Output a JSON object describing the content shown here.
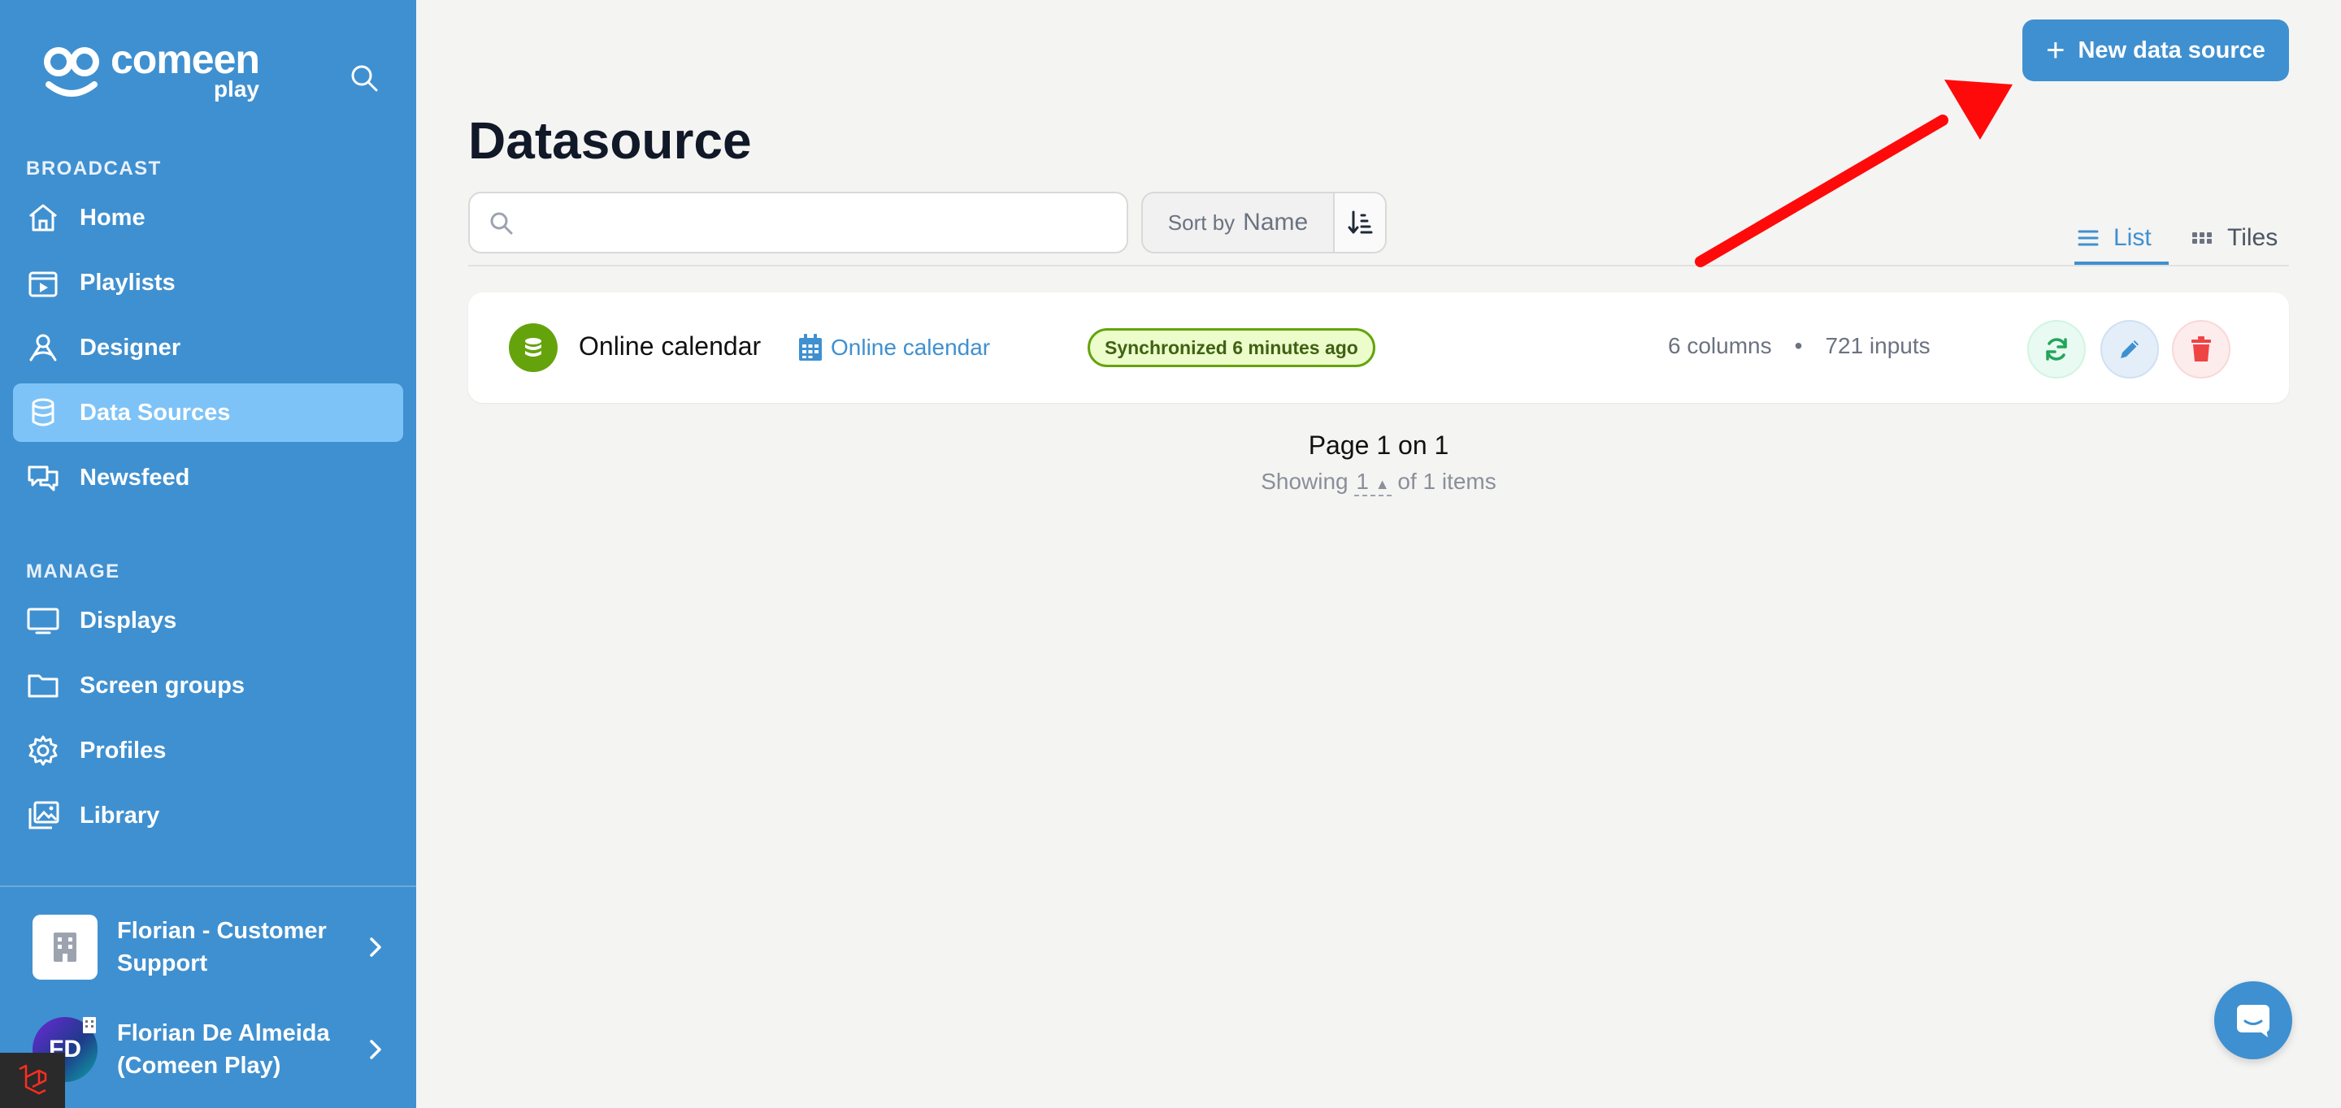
{
  "app": {
    "logo_text": "comeen",
    "logo_sub": "play"
  },
  "sidebar": {
    "sections": [
      {
        "label": "BROADCAST",
        "items": [
          {
            "label": "Home",
            "icon": "home-icon"
          },
          {
            "label": "Playlists",
            "icon": "playlist-icon"
          },
          {
            "label": "Designer",
            "icon": "designer-icon"
          },
          {
            "label": "Data Sources",
            "icon": "database-icon",
            "active": true
          },
          {
            "label": "Newsfeed",
            "icon": "newsfeed-icon"
          }
        ]
      },
      {
        "label": "MANAGE",
        "items": [
          {
            "label": "Displays",
            "icon": "display-icon"
          },
          {
            "label": "Screen groups",
            "icon": "folder-icon"
          },
          {
            "label": "Profiles",
            "icon": "gear-icon"
          },
          {
            "label": "Library",
            "icon": "library-icon"
          }
        ]
      }
    ],
    "org": {
      "name": "Florian - Customer Support"
    },
    "user": {
      "name": "Florian De Almeida (Comeen Play)",
      "initials": "FD"
    }
  },
  "header": {
    "title": "Datasource",
    "new_button": "New data source",
    "search": {
      "value": "",
      "placeholder": ""
    },
    "sort": {
      "prefix": "Sort by",
      "field": "Name"
    },
    "views": {
      "list": "List",
      "tiles": "Tiles",
      "active": "List"
    }
  },
  "datasources": [
    {
      "name": "Online calendar",
      "type": "Online calendar",
      "status": "Synchronized 6 minutes ago",
      "columns": "6 columns",
      "inputs": "721 inputs"
    }
  ],
  "pagination": {
    "title": "Page 1 on 1",
    "showing_prefix": "Showing",
    "per_page": "1",
    "showing_suffix": "of 1 items"
  },
  "colors": {
    "sidebar": "#3f90d0",
    "active_item": "#7ec3f7",
    "accent": "#3f90d0",
    "success": "#65a30d",
    "danger": "#ef4444",
    "annotation_arrow": "#ff0000"
  }
}
